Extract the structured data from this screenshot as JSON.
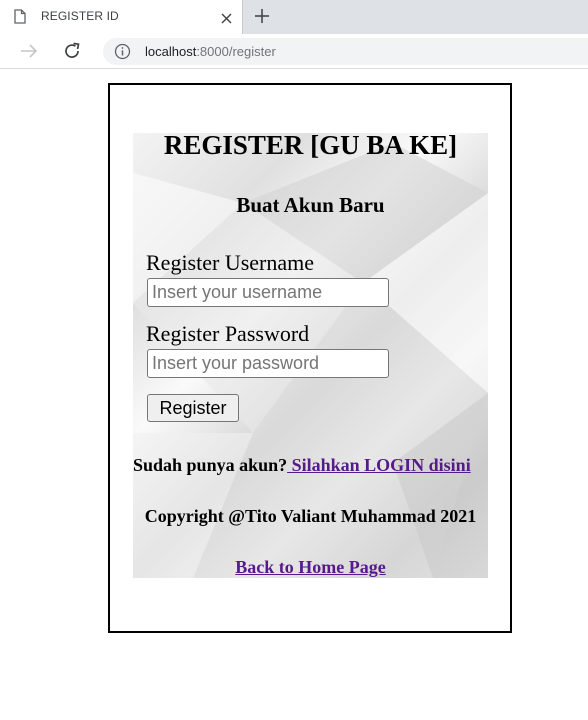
{
  "browser": {
    "tab_title": "REGISTER ID",
    "url_host": "localhost",
    "url_path": ":8000/register"
  },
  "icons": {
    "favicon": "page-icon",
    "close": "close-icon",
    "new_tab": "plus-icon",
    "forward": "arrow-right-icon",
    "reload": "reload-icon",
    "info": "info-icon"
  },
  "page": {
    "title": "REGISTER [GU BA KE]",
    "subtitle": "Buat Akun Baru",
    "username_label": "Register Username",
    "username_placeholder": "Insert your username",
    "username_value": "",
    "password_label": "Register Password",
    "password_placeholder": "Insert your password",
    "password_value": "",
    "register_button": "Register",
    "login_prompt": "Sudah punya akun?",
    "login_link": " Silahkan LOGIN disini",
    "copyright": "Copyright @Tito Valiant Muhammad 2021",
    "home_link": "Back to Home Page"
  },
  "colors": {
    "link": "#551a8b",
    "tabbar": "#dee1e6",
    "omnibox": "#f1f3f4"
  }
}
